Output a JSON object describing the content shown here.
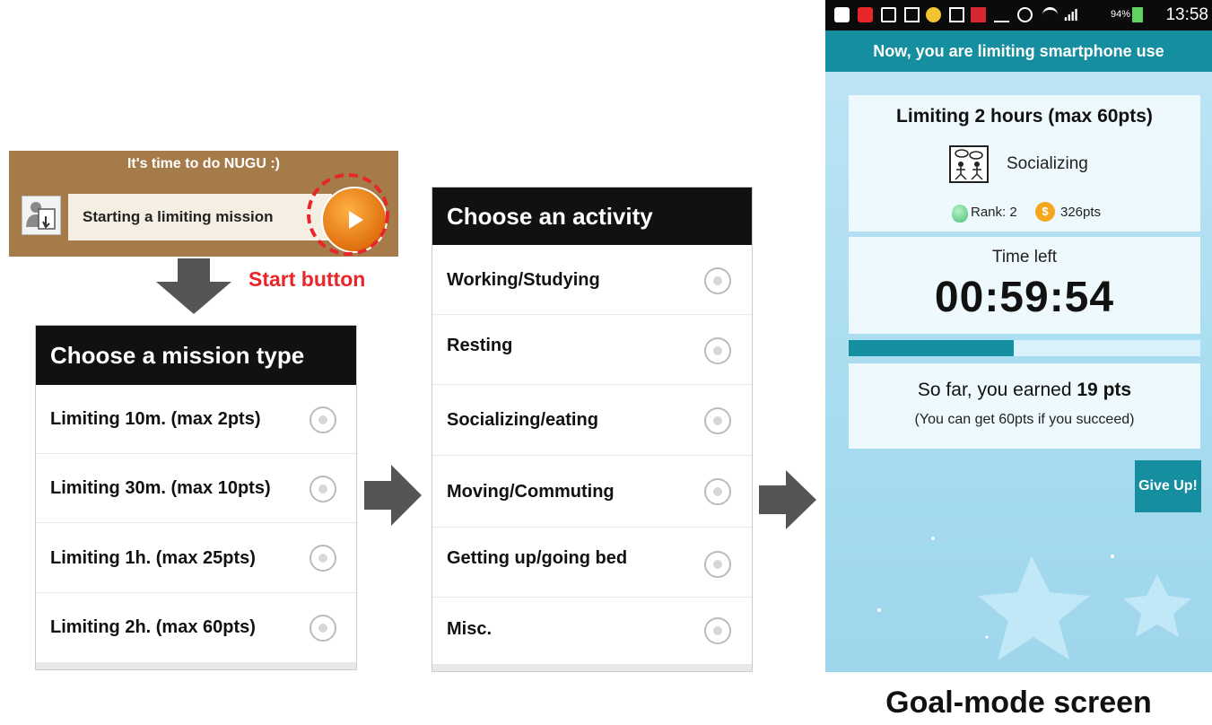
{
  "notification": {
    "title": "It's time to do NUGU :)",
    "label": "Starting a limiting mission"
  },
  "start_caption": "Start button",
  "mission_panel": {
    "header": "Choose a mission type",
    "options": [
      "Limiting 10m. (max 2pts)",
      "Limiting 30m. (max 10pts)",
      "Limiting 1h. (max 25pts)",
      "Limiting 2h. (max 60pts)"
    ]
  },
  "activity_panel": {
    "header": "Choose an activity",
    "options": [
      "Working/Studying",
      "Resting",
      "Socializing/eating",
      "Moving/Commuting",
      "Getting up/going bed",
      "Misc."
    ]
  },
  "phone": {
    "status": {
      "battery": "94%",
      "time": "13:58"
    },
    "topbar": "Now, you are limiting smartphone use",
    "mission_title": "Limiting 2 hours (max 60pts)",
    "activity": "Socializing",
    "rank": "Rank: 2",
    "coin_symbol": "$",
    "points": "326pts",
    "time_left_label": "Time left",
    "timer": "00:59:54",
    "progress": 0.47,
    "earned_prefix": "So far, you earned ",
    "earned_value": "19 pts",
    "earned_note": "(You can get 60pts if you succeed)",
    "give_up": "Give Up!"
  },
  "goal_caption": "Goal-mode screen",
  "colors": {
    "accent": "#158ea0",
    "notification_bg": "#a57b4a",
    "start_orange": "#e0700f",
    "callout_red": "#e8262a"
  }
}
